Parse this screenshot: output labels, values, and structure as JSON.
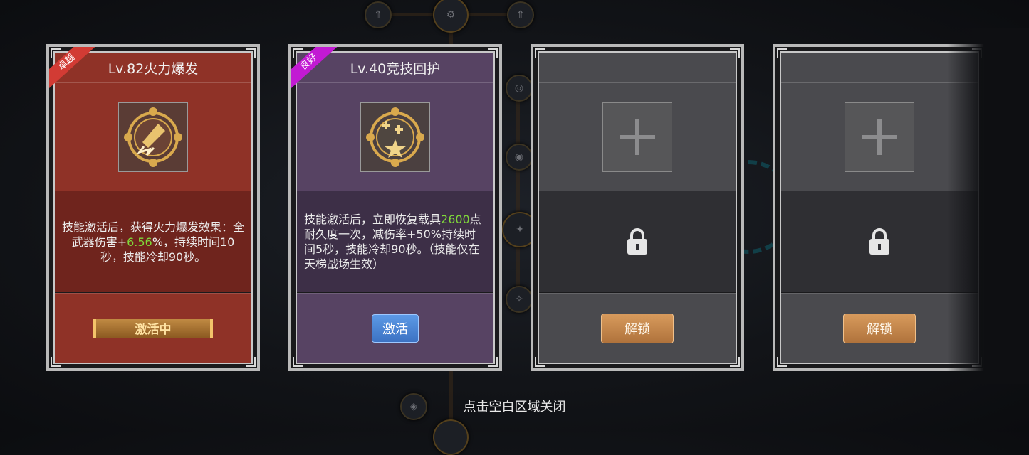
{
  "cards": [
    {
      "quality": "卓越",
      "title": "Lv.82火力爆发",
      "desc_parts": [
        "技能激活后，获得火力爆发效果：全武器伤害+",
        "6.56",
        "%，持续时间10秒，技能冷却90秒。"
      ],
      "button": "激活中",
      "icon": "rocket-burst-icon"
    },
    {
      "quality": "良好",
      "title": "Lv.40竞技回护",
      "desc_parts": [
        "技能激活后，立即恢复载具",
        "2600",
        "点耐久度一次，减伤率+50%持续时间5秒，技能冷却90秒。（技能仅在天梯战场生效）"
      ],
      "button": "激活",
      "icon": "heal-star-icon"
    },
    {
      "title": "",
      "button": "解锁",
      "icon": "lock-icon"
    },
    {
      "title": "",
      "button": "解锁",
      "icon": "lock-icon"
    }
  ],
  "close_hint": "点击空白区域关闭",
  "colors": {
    "highlight": "#7fd73a",
    "red_card": "#8f3227",
    "purple_card": "#574363",
    "gray_card": "#4a4a4e"
  }
}
